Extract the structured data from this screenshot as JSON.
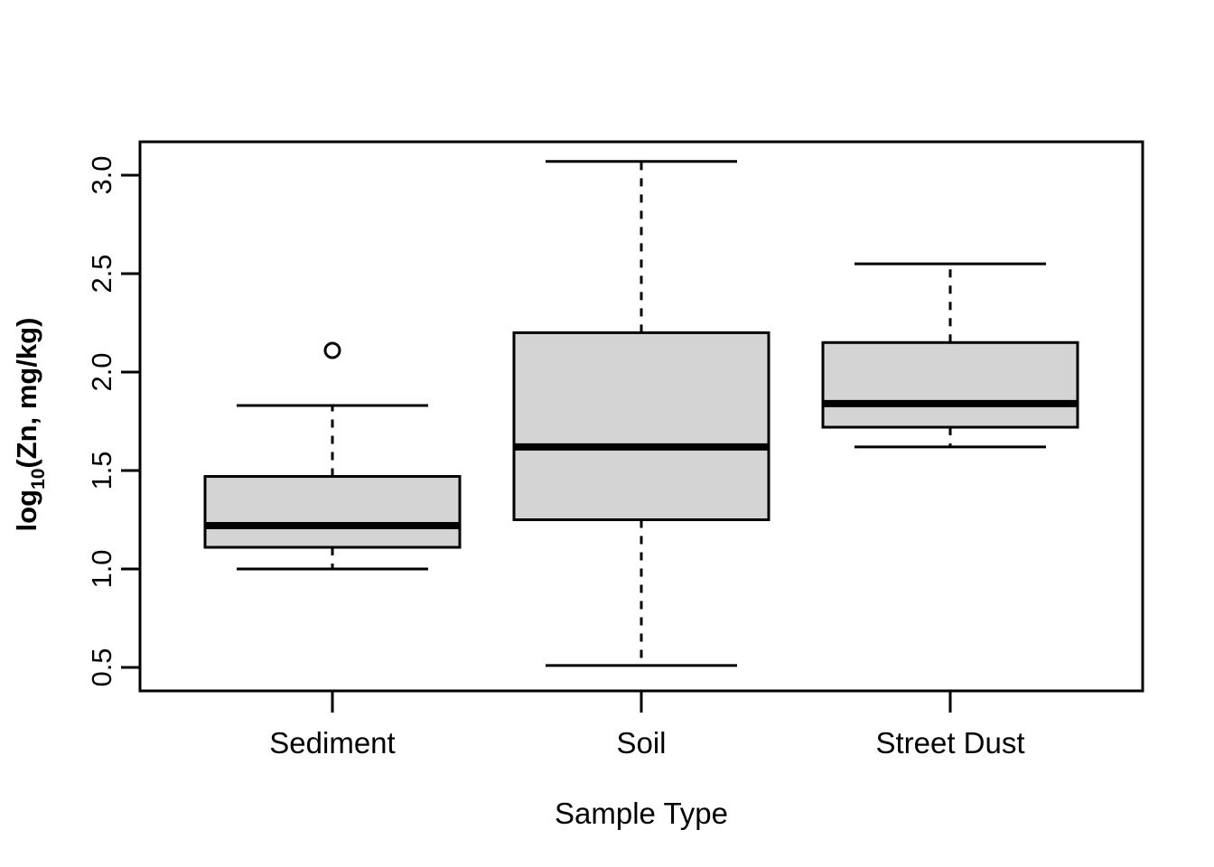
{
  "chart_data": {
    "type": "box",
    "title": "",
    "xlabel": "Sample Type",
    "ylabel_parts": {
      "prefix": "log",
      "subscript": "10",
      "suffix": "(Zn, mg/kg)"
    },
    "ylabel": "log10(Zn, mg/kg)",
    "categories": [
      "Sediment",
      "Soil",
      "Street Dust"
    ],
    "ylim": [
      0.42,
      3.21
    ],
    "y_ticks": [
      0.5,
      1.0,
      1.5,
      2.0,
      2.5,
      3.0
    ],
    "y_tick_labels": [
      "0.5",
      "1.0",
      "1.5",
      "2.0",
      "2.5",
      "3.0"
    ],
    "grid": false,
    "legend": "none",
    "box_fill_color": "#d4d4d4",
    "line_color": "#000000",
    "boxes": [
      {
        "category": "Sediment",
        "whisker_low": 1.0,
        "q1": 1.11,
        "median": 1.22,
        "q3": 1.47,
        "whisker_high": 1.83,
        "outliers": [
          2.11
        ]
      },
      {
        "category": "Soil",
        "whisker_low": 0.51,
        "q1": 1.25,
        "median": 1.62,
        "q3": 2.2,
        "whisker_high": 3.07,
        "outliers": []
      },
      {
        "category": "Street Dust",
        "whisker_low": 1.62,
        "q1": 1.72,
        "median": 1.84,
        "q3": 2.15,
        "whisker_high": 2.55,
        "outliers": []
      }
    ]
  },
  "axes": {
    "y_tick_labels": [
      "3.0",
      "2.5",
      "2.0",
      "1.5",
      "1.0",
      "0.5"
    ],
    "x_tick_labels": [
      "Sediment",
      "Soil",
      "Street Dust"
    ]
  },
  "labels": {
    "x_axis_title": "Sample Type",
    "y_axis_prefix": "log",
    "y_axis_subscript": "10",
    "y_axis_suffix": "(Zn, mg/kg)"
  }
}
